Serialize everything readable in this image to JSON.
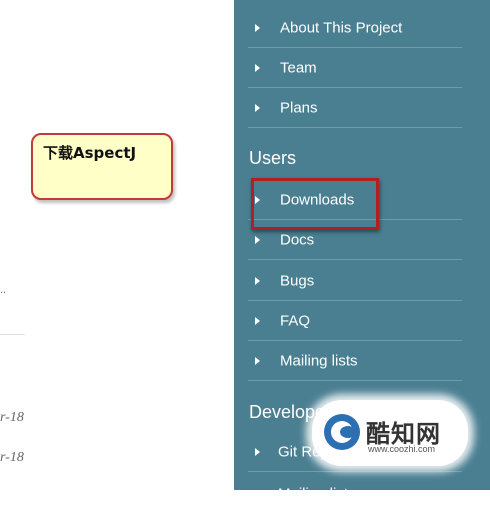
{
  "left_pane": {
    "link_fragment": "..",
    "date_fragments": [
      "r-18",
      "r-18"
    ]
  },
  "callout": {
    "text": "下载AspectJ"
  },
  "sidebar": {
    "project_items": [
      {
        "label": "About This Project"
      },
      {
        "label": "Team"
      },
      {
        "label": "Plans"
      }
    ],
    "users_heading": "Users",
    "user_items": [
      {
        "label": "Downloads"
      },
      {
        "label": "Docs"
      },
      {
        "label": "Bugs"
      },
      {
        "label": "FAQ"
      },
      {
        "label": "Mailing lists"
      }
    ],
    "developers_heading": "Developers",
    "developer_items": [
      {
        "label": "Git Repo"
      },
      {
        "label": "Mailing lists"
      }
    ]
  },
  "watermark": {
    "name": "酷知网",
    "url": "www.coozhi.com"
  },
  "colors": {
    "sidebar_bg": "#4a7f92",
    "callout_bg": "#ffffc8",
    "highlight": "#b02020"
  }
}
